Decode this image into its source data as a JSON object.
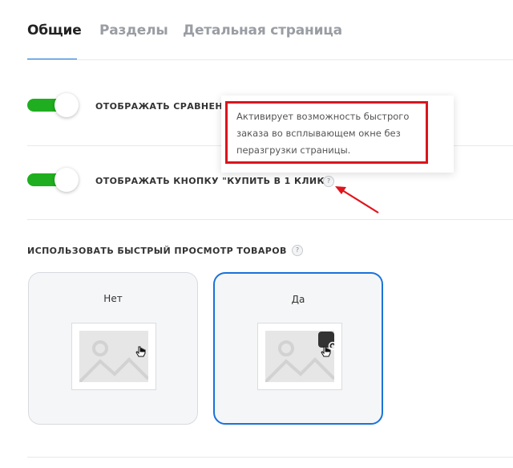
{
  "tabs": [
    {
      "label": "Общие",
      "active": true
    },
    {
      "label": "Разделы",
      "active": false
    },
    {
      "label": "Детальная страница",
      "active": false
    }
  ],
  "options": {
    "compare": {
      "label": "ОТОБРАЖАТЬ СРАВНЕНИЕ",
      "enabled": true
    },
    "one_click": {
      "label": "ОТОБРАЖАТЬ КНОПКУ \"КУПИТЬ В 1 КЛИК\"",
      "enabled": true,
      "help": "?"
    }
  },
  "tooltip": {
    "text": "Активирует возможность быстрого заказа во всплывающем окне без перазгрузки страницы."
  },
  "quick_view": {
    "title": "ИСПОЛЬЗОВАТЬ БЫСТРЫЙ ПРОСМОТР ТОВАРОВ",
    "help": "?",
    "choices": [
      {
        "label": "Нет",
        "selected": false
      },
      {
        "label": "Да",
        "selected": true
      }
    ]
  },
  "colors": {
    "accent": "#1a73d9",
    "toggle_on": "#1fae1f",
    "highlight": "#d9151c"
  }
}
